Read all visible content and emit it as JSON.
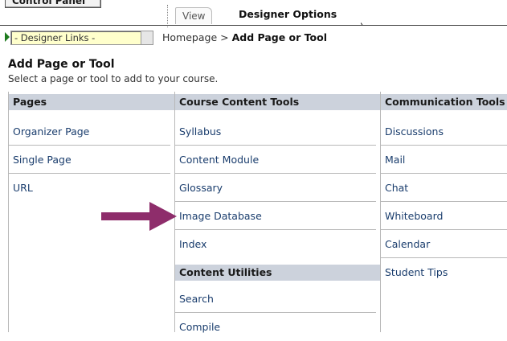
{
  "tabs": {
    "control_panel": "Control Panel",
    "view": "View",
    "designer_options": "Designer Options"
  },
  "designer_links": {
    "selected": "- Designer Links -"
  },
  "breadcrumb": {
    "home": "Homepage",
    "separator": ">",
    "current": "Add Page or Tool"
  },
  "page": {
    "title": "Add Page or Tool",
    "subtitle": "Select a page or tool to add to your course."
  },
  "columns": {
    "pages": {
      "header": "Pages",
      "items": [
        "Organizer Page",
        "Single Page",
        "URL"
      ]
    },
    "course_content_tools": {
      "header": "Course Content Tools",
      "items": [
        "Syllabus",
        "Content Module",
        "Glossary",
        "Image Database",
        "Index"
      ]
    },
    "content_utilities": {
      "header": "Content Utilities",
      "items": [
        "Search",
        "Compile"
      ]
    },
    "communication_tools": {
      "header": "Communication Tools",
      "items": [
        "Discussions",
        "Mail",
        "Chat",
        "Whiteboard",
        "Calendar",
        "Student Tips"
      ]
    }
  },
  "colors": {
    "header_bg": "#ccd2dc",
    "link_text": "#1a3d6d",
    "arrow": "#8e2d6b",
    "select_bg": "#ffffcc"
  }
}
